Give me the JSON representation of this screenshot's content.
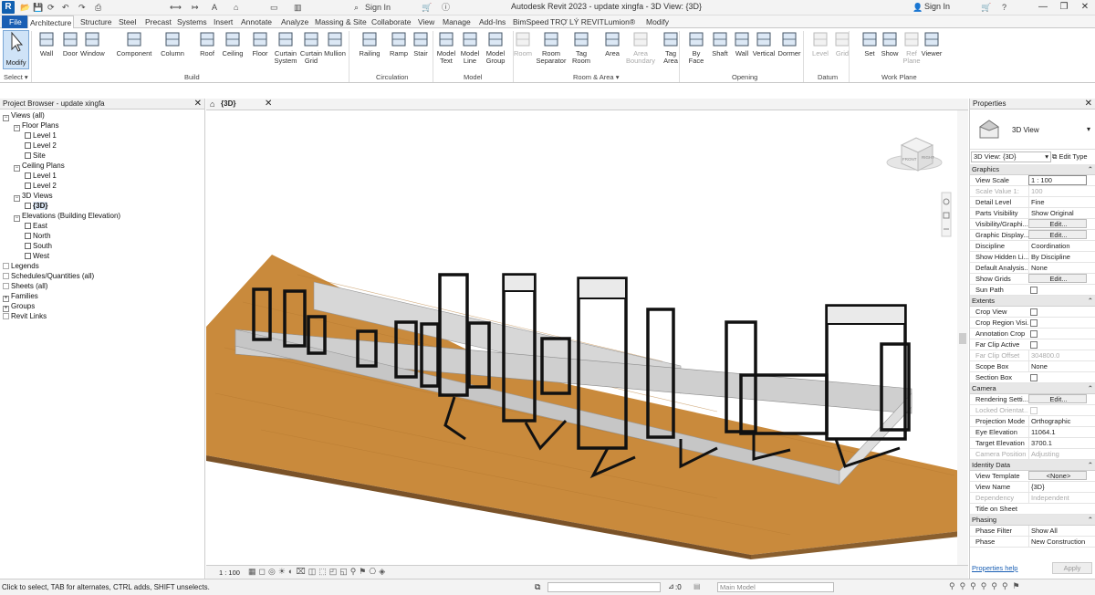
{
  "titlebar": {
    "logo": "R",
    "title": "Autodesk Revit 2023 - update xingfa - 3D View: {3D}",
    "signin_left": "Sign In",
    "signin_right": "Sign In",
    "minimize": "—",
    "restore": "❐",
    "close": "✕"
  },
  "tabs": [
    "File",
    "Architecture",
    "Structure",
    "Steel",
    "Precast",
    "Systems",
    "Insert",
    "Annotate",
    "Analyze",
    "Massing & Site",
    "Collaborate",
    "View",
    "Manage",
    "Add-Ins",
    "BimSpeed",
    "TRỢ LÝ REVIT",
    "Lumion®",
    "Modify"
  ],
  "ribbon": {
    "modify": "Modify",
    "select": "Select ▾",
    "buttons": [
      {
        "label": "Wall",
        "l2": "",
        "icon": "wall-icon"
      },
      {
        "label": "Door",
        "l2": "",
        "icon": "door-icon"
      },
      {
        "label": "Window",
        "l2": "",
        "icon": "window-icon"
      },
      {
        "label": "Component",
        "l2": "",
        "icon": "component-icon"
      },
      {
        "label": "Column",
        "l2": "",
        "icon": "column-icon"
      },
      {
        "label": "Roof",
        "l2": "",
        "icon": "roof-icon"
      },
      {
        "label": "Ceiling",
        "l2": "",
        "icon": "ceiling-icon"
      },
      {
        "label": "Floor",
        "l2": "",
        "icon": "floor-icon"
      },
      {
        "label": "Curtain",
        "l2": "System",
        "icon": "curtain-system-icon"
      },
      {
        "label": "Curtain",
        "l2": "Grid",
        "icon": "curtain-grid-icon"
      },
      {
        "label": "Mullion",
        "l2": "",
        "icon": "mullion-icon"
      },
      {
        "label": "Railing",
        "l2": "",
        "icon": "railing-icon"
      },
      {
        "label": "Ramp",
        "l2": "",
        "icon": "ramp-icon"
      },
      {
        "label": "Stair",
        "l2": "",
        "icon": "stair-icon"
      },
      {
        "label": "Model",
        "l2": "Text",
        "icon": "model-text-icon"
      },
      {
        "label": "Model",
        "l2": "Line",
        "icon": "model-line-icon"
      },
      {
        "label": "Model",
        "l2": "Group",
        "icon": "model-group-icon"
      },
      {
        "label": "Room",
        "l2": "",
        "icon": "room-icon"
      },
      {
        "label": "Room",
        "l2": "Separator",
        "icon": "room-separator-icon"
      },
      {
        "label": "Tag",
        "l2": "Room",
        "icon": "tag-room-icon"
      },
      {
        "label": "Area",
        "l2": "",
        "icon": "area-icon"
      },
      {
        "label": "Area",
        "l2": "Boundary",
        "icon": "area-boundary-icon"
      },
      {
        "label": "Tag",
        "l2": "Area",
        "icon": "tag-area-icon"
      },
      {
        "label": "By",
        "l2": "Face",
        "icon": "by-face-icon"
      },
      {
        "label": "Shaft",
        "l2": "",
        "icon": "shaft-icon"
      },
      {
        "label": "Wall",
        "l2": "",
        "icon": "wall-opening-icon"
      },
      {
        "label": "Vertical",
        "l2": "",
        "icon": "vertical-icon"
      },
      {
        "label": "Dormer",
        "l2": "",
        "icon": "dormer-icon"
      },
      {
        "label": "Level",
        "l2": "",
        "icon": "level-icon"
      },
      {
        "label": "Grid",
        "l2": "",
        "icon": "grid-icon"
      },
      {
        "label": "Set",
        "l2": "",
        "icon": "set-icon"
      },
      {
        "label": "Show",
        "l2": "",
        "icon": "show-icon"
      },
      {
        "label": "Ref",
        "l2": "Plane",
        "icon": "ref-plane-icon"
      },
      {
        "label": "Viewer",
        "l2": "",
        "icon": "viewer-icon"
      }
    ],
    "groups": [
      "Build",
      "Circulation",
      "Model",
      "Room & Area ▾",
      "Opening",
      "Datum",
      "Work Plane"
    ]
  },
  "browser": {
    "title": "Project Browser - update xingfa",
    "items": [
      {
        "label": "Views (all)",
        "lvl": 0,
        "pm": "−"
      },
      {
        "label": "Floor Plans",
        "lvl": 1,
        "pm": "−"
      },
      {
        "label": "Level 1",
        "lvl": 2,
        "pm": ""
      },
      {
        "label": "Level 2",
        "lvl": 2,
        "pm": ""
      },
      {
        "label": "Site",
        "lvl": 2,
        "pm": ""
      },
      {
        "label": "Ceiling Plans",
        "lvl": 1,
        "pm": "−"
      },
      {
        "label": "Level 1",
        "lvl": 2,
        "pm": ""
      },
      {
        "label": "Level 2",
        "lvl": 2,
        "pm": ""
      },
      {
        "label": "3D Views",
        "lvl": 1,
        "pm": "−"
      },
      {
        "label": "{3D}",
        "lvl": 2,
        "pm": ""
      },
      {
        "label": "Elevations (Building Elevation)",
        "lvl": 1,
        "pm": "−"
      },
      {
        "label": "East",
        "lvl": 2,
        "pm": ""
      },
      {
        "label": "North",
        "lvl": 2,
        "pm": ""
      },
      {
        "label": "South",
        "lvl": 2,
        "pm": ""
      },
      {
        "label": "West",
        "lvl": 2,
        "pm": ""
      },
      {
        "label": "Legends",
        "lvl": 0,
        "pm": ""
      },
      {
        "label": "Schedules/Quantities (all)",
        "lvl": 0,
        "pm": ""
      },
      {
        "label": "Sheets (all)",
        "lvl": 0,
        "pm": ""
      },
      {
        "label": "Families",
        "lvl": 0,
        "pm": "+"
      },
      {
        "label": "Groups",
        "lvl": 0,
        "pm": "+"
      },
      {
        "label": "Revit Links",
        "lvl": 0,
        "pm": ""
      }
    ]
  },
  "view": {
    "tab_label": "{3D}",
    "scale": "1 : 100",
    "viewcube_face": "FRONT",
    "viewcube_side": "RIGHT"
  },
  "props": {
    "title": "Properties",
    "type_name": "3D View",
    "selector": "3D View: {3D}",
    "edit_type": "Edit Type",
    "help": "Properties help",
    "apply": "Apply",
    "sections": [
      {
        "head": "Graphics",
        "rows": [
          {
            "k": "View Scale",
            "v": "1 : 100",
            "t": "input"
          },
          {
            "k": "Scale Value    1:",
            "v": "100",
            "t": "dis"
          },
          {
            "k": "Detail Level",
            "v": "Fine",
            "t": "text"
          },
          {
            "k": "Parts Visibility",
            "v": "Show Original",
            "t": "text"
          },
          {
            "k": "Visibility/Graphi...",
            "v": "Edit...",
            "t": "btn"
          },
          {
            "k": "Graphic Display...",
            "v": "Edit...",
            "t": "btn"
          },
          {
            "k": "Discipline",
            "v": "Coordination",
            "t": "text"
          },
          {
            "k": "Show Hidden Li...",
            "v": "By Discipline",
            "t": "text"
          },
          {
            "k": "Default Analysis...",
            "v": "None",
            "t": "text"
          },
          {
            "k": "Show Grids",
            "v": "Edit...",
            "t": "btn"
          },
          {
            "k": "Sun Path",
            "v": "",
            "t": "cb"
          }
        ]
      },
      {
        "head": "Extents",
        "rows": [
          {
            "k": "Crop View",
            "v": "",
            "t": "cb"
          },
          {
            "k": "Crop Region Visi...",
            "v": "",
            "t": "cb"
          },
          {
            "k": "Annotation Crop",
            "v": "",
            "t": "cb"
          },
          {
            "k": "Far Clip Active",
            "v": "",
            "t": "cb"
          },
          {
            "k": "Far Clip Offset",
            "v": "304800.0",
            "t": "dis"
          },
          {
            "k": "Scope Box",
            "v": "None",
            "t": "text"
          },
          {
            "k": "Section Box",
            "v": "",
            "t": "cb"
          }
        ]
      },
      {
        "head": "Camera",
        "rows": [
          {
            "k": "Rendering Setti...",
            "v": "Edit...",
            "t": "btn"
          },
          {
            "k": "Locked Orientat...",
            "v": "",
            "t": "cbdis"
          },
          {
            "k": "Projection Mode",
            "v": "Orthographic",
            "t": "text"
          },
          {
            "k": "Eye Elevation",
            "v": "11064.1",
            "t": "text"
          },
          {
            "k": "Target Elevation",
            "v": "3700.1",
            "t": "text"
          },
          {
            "k": "Camera Position",
            "v": "Adjusting",
            "t": "dis"
          }
        ]
      },
      {
        "head": "Identity Data",
        "rows": [
          {
            "k": "View Template",
            "v": "<None>",
            "t": "btn"
          },
          {
            "k": "View Name",
            "v": "{3D}",
            "t": "text"
          },
          {
            "k": "Dependency",
            "v": "Independent",
            "t": "dis"
          },
          {
            "k": "Title on Sheet",
            "v": "",
            "t": "text"
          }
        ]
      },
      {
        "head": "Phasing",
        "rows": [
          {
            "k": "Phase Filter",
            "v": "Show All",
            "t": "text"
          },
          {
            "k": "Phase",
            "v": "New Construction",
            "t": "text"
          }
        ]
      }
    ]
  },
  "status": {
    "hint": "Click to select, TAB for alternates, CTRL adds, SHIFT unselects.",
    "zero": ":0",
    "model": "Main Model"
  }
}
